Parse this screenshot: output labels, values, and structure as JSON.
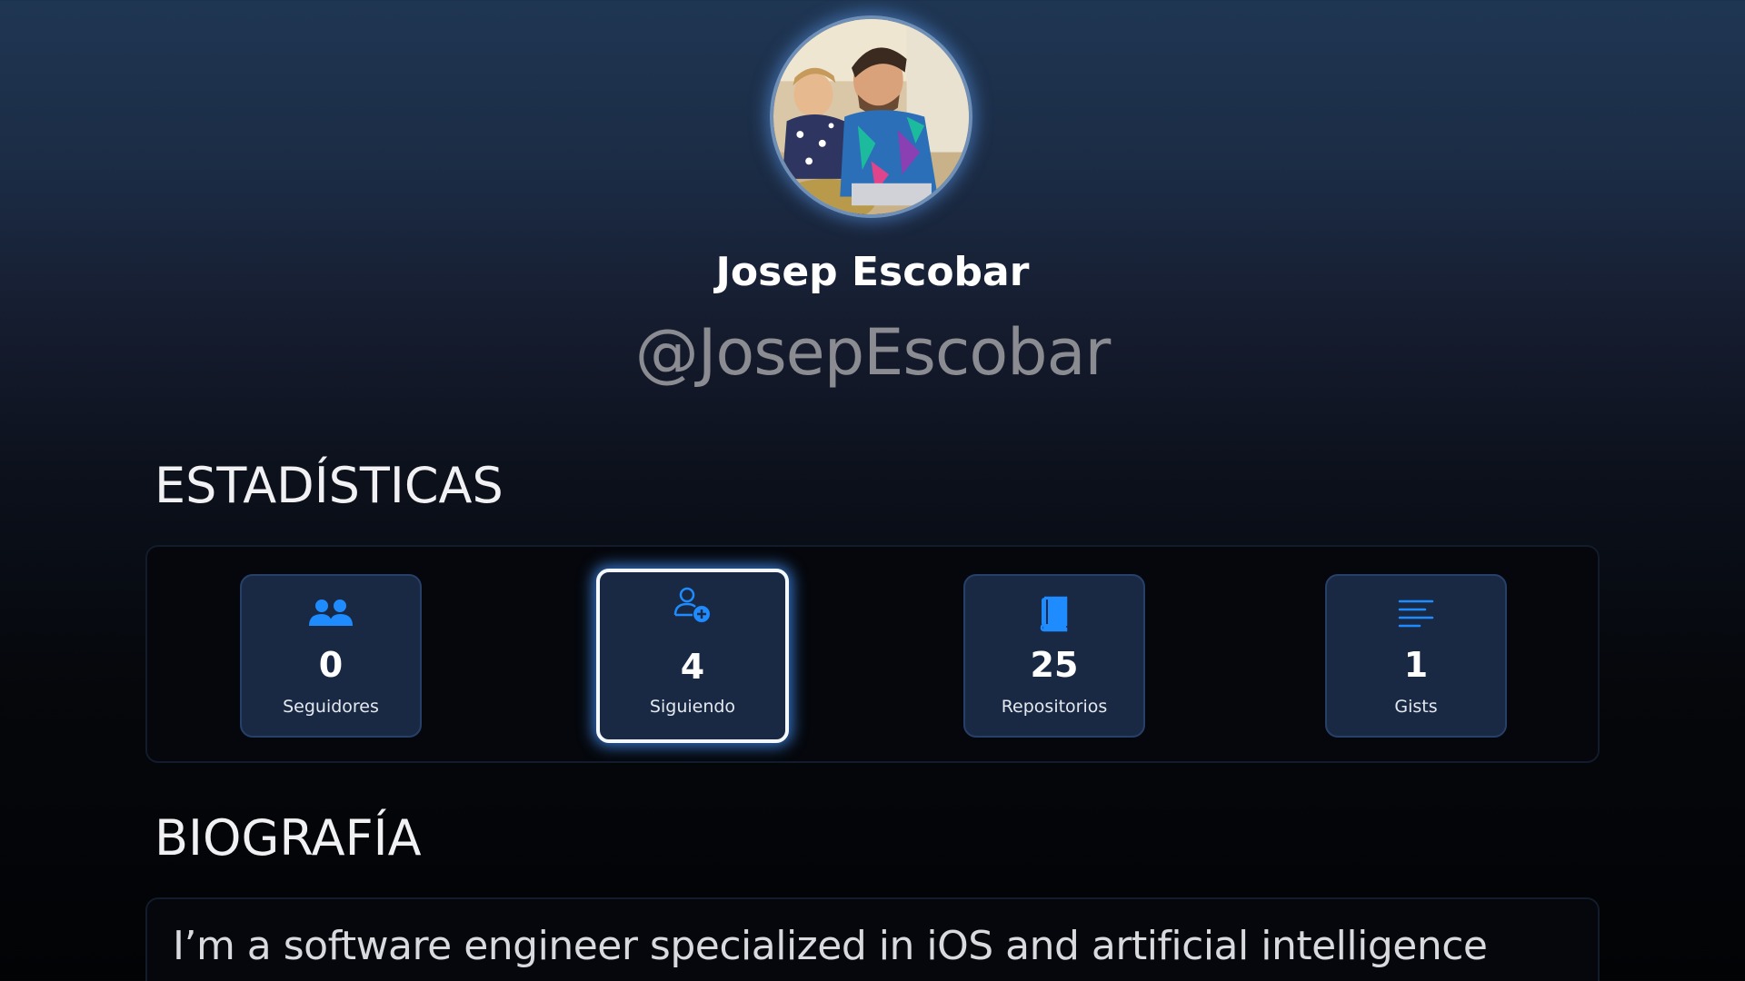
{
  "profile": {
    "name": "Josep Escobar",
    "handle": "@JosepEscobar"
  },
  "sections": {
    "stats_title": "ESTADÍSTICAS",
    "bio_title": "BIOGRAFÍA"
  },
  "stats": [
    {
      "icon": "people-icon",
      "value": "0",
      "label": "Seguidores",
      "selected": false
    },
    {
      "icon": "person-add-icon",
      "value": "4",
      "label": "Siguiendo",
      "selected": true
    },
    {
      "icon": "book-icon",
      "value": "25",
      "label": "Repositorios",
      "selected": false
    },
    {
      "icon": "text-lines-icon",
      "value": "1",
      "label": "Gists",
      "selected": false
    }
  ],
  "bio": {
    "text": "I’m a software engineer specialized in iOS and artificial intelligence"
  },
  "colors": {
    "accent": "#1e8bff",
    "card_bg": "#1a2943",
    "panel_bg": "#05070c",
    "handle_gray": "#8a8c92"
  }
}
